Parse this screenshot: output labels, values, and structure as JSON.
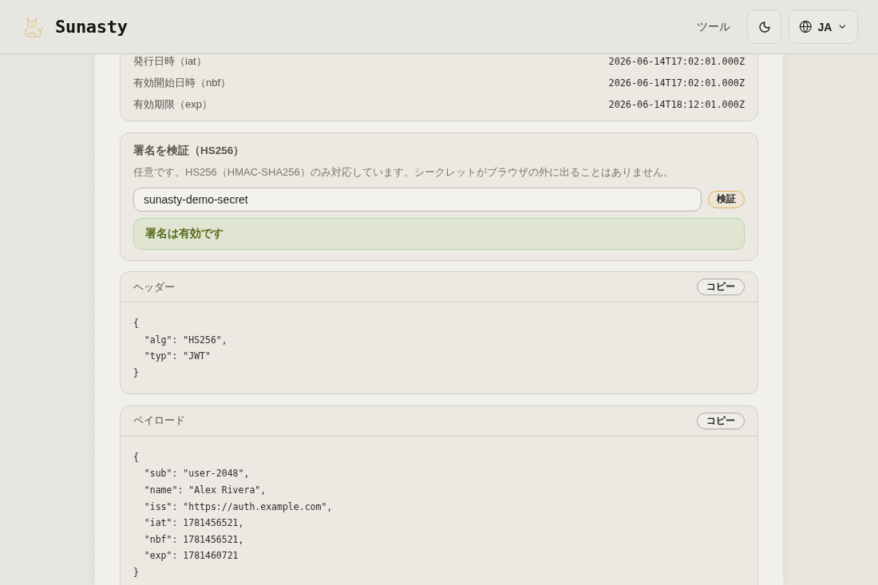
{
  "app_bar": {
    "brand": "Sunasty",
    "nav_link": "ツール",
    "language": "JA"
  },
  "claims": [
    {
      "label": "発行日時（iat）",
      "value": "2026-06-14T17:02:01.000Z"
    },
    {
      "label": "有効開始日時（nbf）",
      "value": "2026-06-14T17:02:01.000Z"
    },
    {
      "label": "有効期限（exp）",
      "value": "2026-06-14T18:12:01.000Z"
    }
  ],
  "signature": {
    "title": "署名を検証（HS256）",
    "description": "任意です。HS256（HMAC-SHA256）のみ対応しています。シークレットがブラウザの外に出ることはありません。",
    "secret": {
      "value": "sunasty-demo-secret"
    },
    "verify_button": "検証",
    "result": {
      "kind": "success",
      "message": "署名は有効です"
    }
  },
  "sections": [
    {
      "title": "ヘッダー",
      "copy_button": "コピー",
      "code": "{\n  \"alg\": \"HS256\",\n  \"typ\": \"JWT\"\n}"
    },
    {
      "title": "ペイロード",
      "copy_button": "コピー",
      "code": "{\n  \"sub\": \"user-2048\",\n  \"name\": \"Alex Rivera\",\n  \"iss\": \"https://auth.example.com\",\n  \"iat\": 1781456521,\n  \"nbf\": 1781456521,\n  \"exp\": 1781460721\n}"
    }
  ]
}
